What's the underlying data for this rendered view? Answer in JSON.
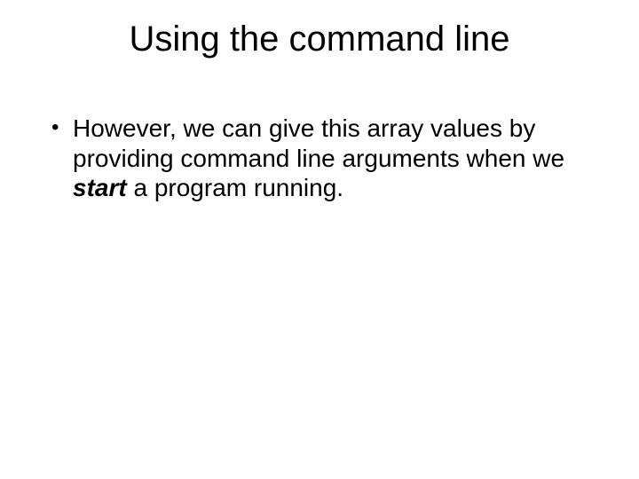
{
  "slide": {
    "title": "Using the command line",
    "bullet1_a": "However, we can give this array values by providing command line arguments when we ",
    "bullet1_emph": "start",
    "bullet1_b": " a program running."
  }
}
